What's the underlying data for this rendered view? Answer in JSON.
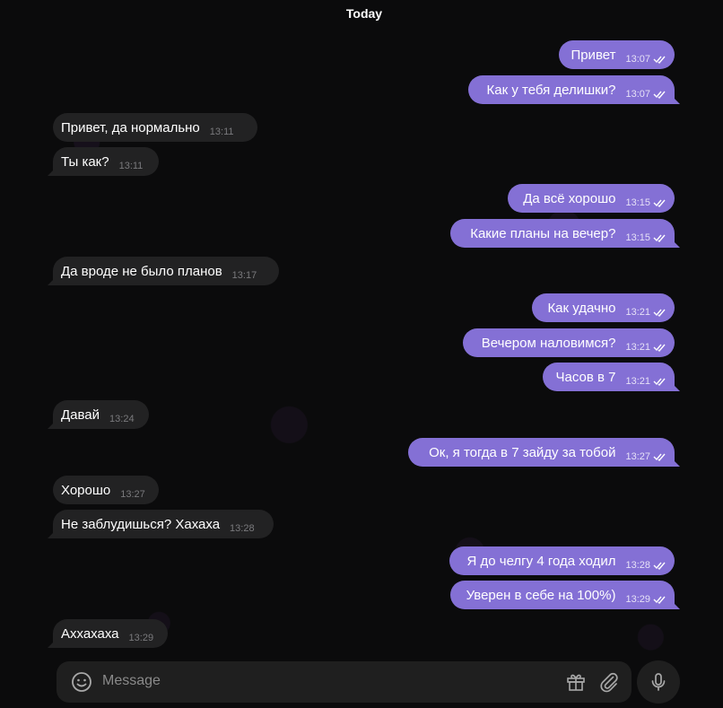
{
  "date_label": "Today",
  "messages": [
    {
      "text": "Привет",
      "time": "13:07"
    },
    {
      "text": "Как у тебя делишки?",
      "time": "13:07"
    },
    {
      "text": "Привет, да нормально",
      "time": "13:11"
    },
    {
      "text": "Ты как?",
      "time": "13:11"
    },
    {
      "text": "Да всё хорошо",
      "time": "13:15"
    },
    {
      "text": "Какие планы на вечер?",
      "time": "13:15"
    },
    {
      "text": "Да вроде не было планов",
      "time": "13:17"
    },
    {
      "text": "Как удачно",
      "time": "13:21"
    },
    {
      "text": "Вечером наловимся?",
      "time": "13:21"
    },
    {
      "text": "Часов в 7",
      "time": "13:21"
    },
    {
      "text": "Давай",
      "time": "13:24"
    },
    {
      "text": "Ок, я тогда в 7 зайду за тобой",
      "time": "13:27"
    },
    {
      "text": "Хорошо",
      "time": "13:27"
    },
    {
      "text": "Не заблудишься? Хахаха",
      "time": "13:28"
    },
    {
      "text": "Я до челгу 4 года ходил",
      "time": "13:28"
    },
    {
      "text": "Уверен в себе на 100%)",
      "time": "13:29"
    },
    {
      "text": "Аххахаха",
      "time": "13:29"
    }
  ],
  "composer": {
    "placeholder": "Message",
    "icons": [
      "smile-icon",
      "gift-icon",
      "paperclip-icon",
      "microphone-icon"
    ]
  },
  "colors": {
    "outgoing_bubble": "#8470d5",
    "incoming_bubble": "#222223",
    "background": "#0b0b0c"
  }
}
